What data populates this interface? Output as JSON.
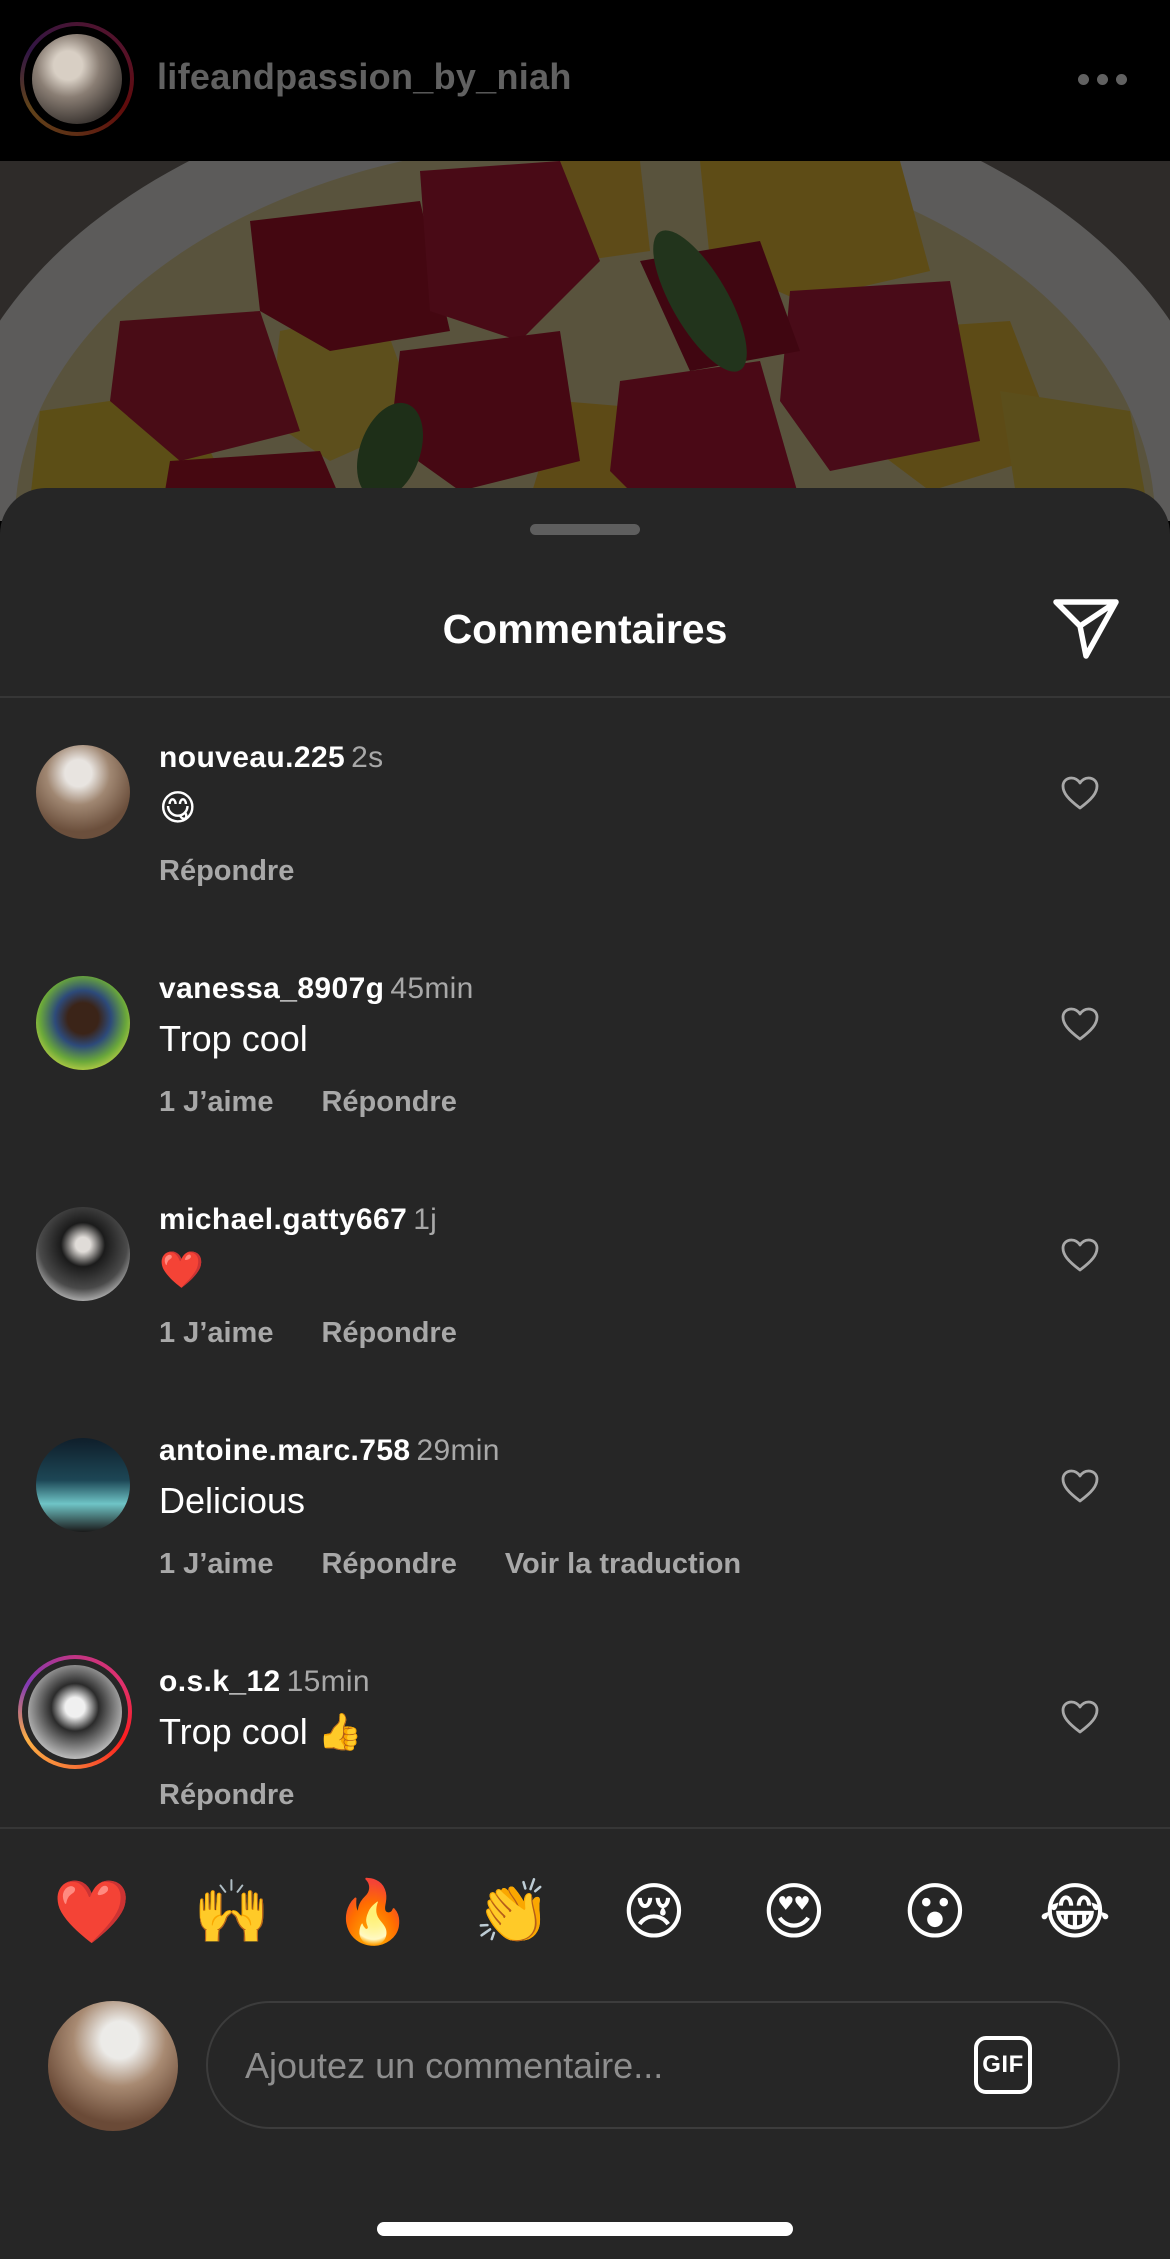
{
  "post": {
    "username": "lifeandpassion_by_niah"
  },
  "sheet": {
    "title": "Commentaires"
  },
  "comments": [
    {
      "username": "nouveau.225",
      "time": "2s",
      "text": "😋",
      "likes": "",
      "reply": "Répondre",
      "translate": ""
    },
    {
      "username": "vanessa_8907g",
      "time": "45min",
      "text": "Trop cool",
      "likes": "1 J’aime",
      "reply": "Répondre",
      "translate": ""
    },
    {
      "username": "michael.gatty667",
      "time": "1j",
      "text": "❤️",
      "likes": "1 J’aime",
      "reply": "Répondre",
      "translate": ""
    },
    {
      "username": "antoine.marc.758",
      "time": "29min",
      "text": "Delicious",
      "likes": "1 J’aime",
      "reply": "Répondre",
      "translate": "Voir la traduction"
    },
    {
      "username": "o.s.k_12",
      "time": "15min",
      "text": "Trop cool 👍",
      "likes": "",
      "reply": "Répondre",
      "translate": ""
    }
  ],
  "quick_reactions": [
    "❤️",
    "🙌",
    "🔥",
    "👏",
    "😢",
    "😍",
    "😮",
    "😂"
  ],
  "composer": {
    "placeholder": "Ajoutez un commentaire...",
    "gif_label": "GIF"
  },
  "icons": {
    "more": "more-horizontal-icon",
    "share": "paper-plane-icon",
    "like": "heart-outline-icon"
  }
}
